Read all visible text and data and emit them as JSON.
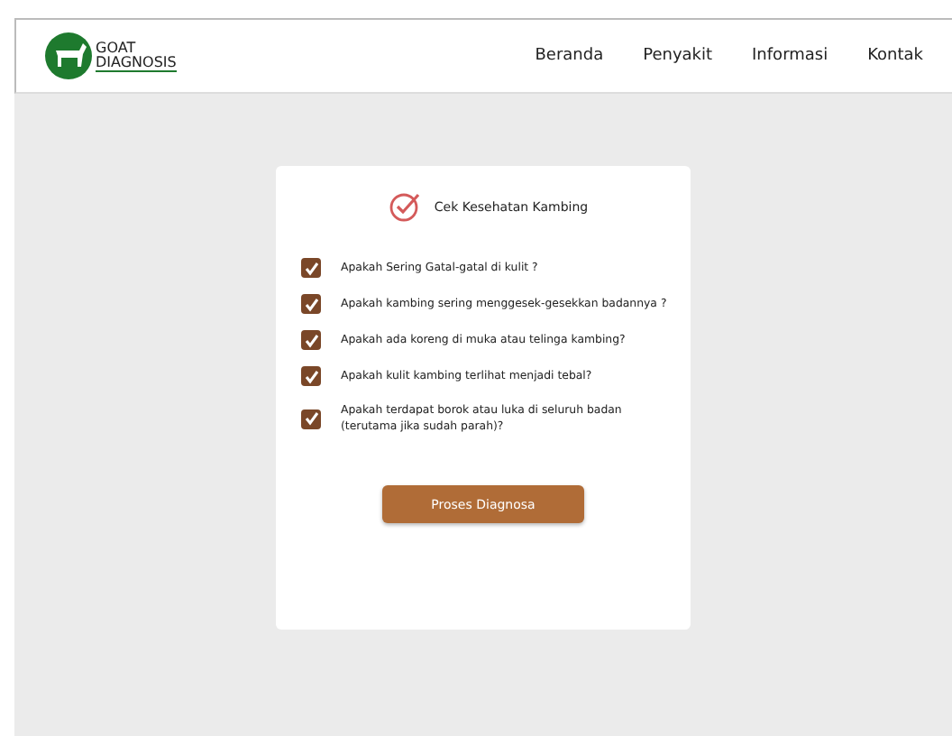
{
  "header": {
    "logo_lines": [
      "GOAT",
      "DIAGNOSIS"
    ],
    "nav": [
      {
        "label": "Beranda"
      },
      {
        "label": "Penyakit"
      },
      {
        "label": "Informasi"
      },
      {
        "label": "Kontak"
      }
    ]
  },
  "card": {
    "title": "Cek Kesehatan Kambing",
    "questions": [
      {
        "text": "Apakah Sering Gatal-gatal di kulit ?",
        "checked": true
      },
      {
        "text": "Apakah kambing sering menggesek-gesekkan badannya ?",
        "checked": true
      },
      {
        "text": "Apakah ada koreng di muka atau telinga kambing?",
        "checked": true
      },
      {
        "text": "Apakah kulit kambing terlihat menjadi tebal?",
        "checked": true
      },
      {
        "text": "Apakah terdapat borok atau luka di seluruh badan (terutama jika sudah parah)?",
        "checked": true
      }
    ],
    "button": "Proses Diagnosa"
  }
}
